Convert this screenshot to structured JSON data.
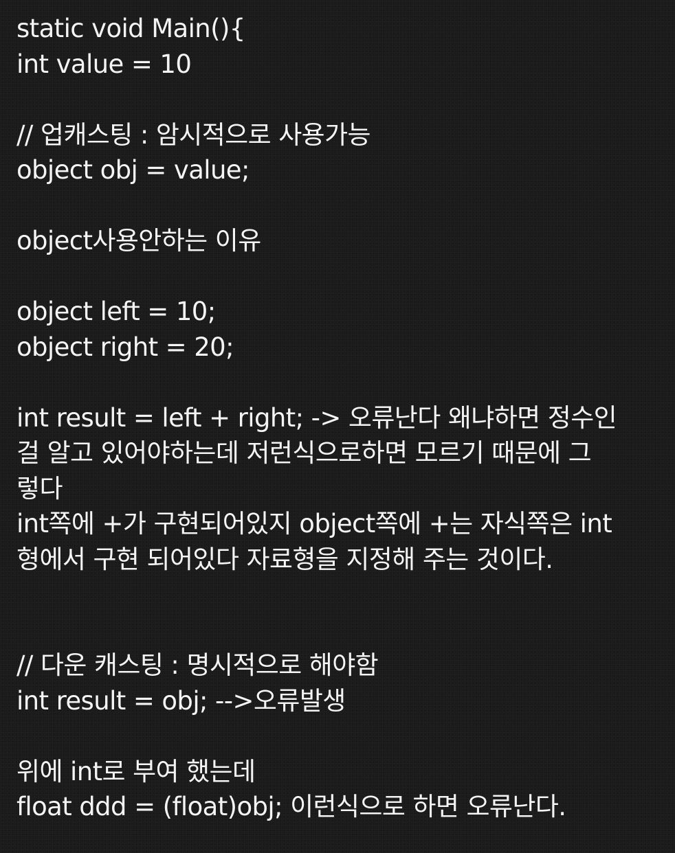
{
  "note": {
    "lines": [
      "static void Main(){",
      "int value = 10",
      "",
      "// 업캐스팅 : 암시적으로 사용가능",
      "object obj = value;",
      "",
      "object사용안하는 이유",
      "",
      "object left = 10;",
      "object right = 20;",
      "",
      "int result = left + right; -> 오류난다 왜냐하면 정수인",
      "걸 알고 있어야하는데 저런식으로하면 모르기 때문에 그",
      "렇다",
      "int쪽에 +가 구현되어있지 object쪽에 +는 자식쪽은 int",
      "형에서 구현 되어있다 자료형을 지정해 주는 것이다.",
      "",
      "",
      "// 다운 캐스팅 : 명시적으로 해야함",
      "int result = obj; -->오류발생",
      "",
      "위에 int로 부여 했는데",
      "float ddd = (float)obj; 이런식으로 하면 오류난다."
    ]
  }
}
